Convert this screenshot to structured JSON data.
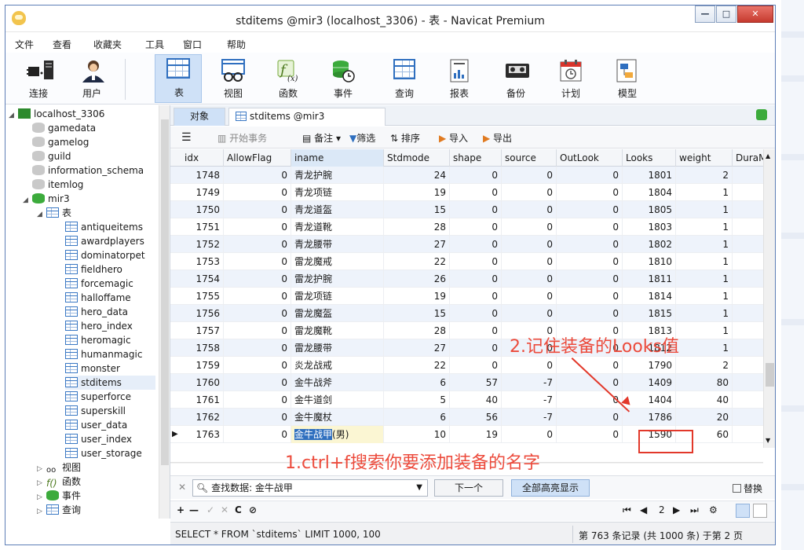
{
  "window": {
    "title": "stditems @mir3 (localhost_3306) - 表 - Navicat Premium"
  },
  "menu": [
    "文件",
    "查看",
    "收藏夹",
    "工具",
    "窗口",
    "帮助"
  ],
  "toolbar": [
    {
      "label": "连接",
      "icon": "plug-icon"
    },
    {
      "label": "用户",
      "icon": "user-icon"
    },
    {
      "label": "表",
      "icon": "table-icon",
      "active": true
    },
    {
      "label": "视图",
      "icon": "view-icon"
    },
    {
      "label": "函数",
      "icon": "function-icon"
    },
    {
      "label": "事件",
      "icon": "event-icon"
    },
    {
      "label": "查询",
      "icon": "query-icon"
    },
    {
      "label": "报表",
      "icon": "report-icon"
    },
    {
      "label": "备份",
      "icon": "backup-icon"
    },
    {
      "label": "计划",
      "icon": "schedule-icon"
    },
    {
      "label": "模型",
      "icon": "model-icon"
    }
  ],
  "tree": {
    "connection": "localhost_3306",
    "databases": [
      "gamedata",
      "gamelog",
      "guild",
      "information_schema",
      "itemlog"
    ],
    "current_db": "mir3",
    "tables_label": "表",
    "tables": [
      "antiqueitems",
      "awardplayers",
      "dominatorpet",
      "fieldhero",
      "forcemagic",
      "halloffame",
      "hero_data",
      "hero_index",
      "heromagic",
      "humanmagic",
      "monster",
      "stditems",
      "superforce",
      "superskill",
      "user_data",
      "user_index",
      "user_storage"
    ],
    "selected_table": "stditems",
    "other_nodes": [
      "视图",
      "函数",
      "事件",
      "查询"
    ]
  },
  "tabs": {
    "objects": "对象",
    "doc": "stditems @mir3 (localhost_3..."
  },
  "subtoolbar": {
    "begin_tx": "开始事务",
    "memo": "备注",
    "filter": "筛选",
    "sort": "排序",
    "import": "导入",
    "export": "导出"
  },
  "grid": {
    "columns": [
      "idx",
      "AllowFlag",
      "iname",
      "Stdmode",
      "shape",
      "source",
      "OutLook",
      "Looks",
      "weight",
      "DuraM"
    ],
    "sorted_column": "iname",
    "rows": [
      [
        "1748",
        "0",
        "青龙护腕",
        "24",
        "0",
        "0",
        "0",
        "1801",
        "2"
      ],
      [
        "1749",
        "0",
        "青龙项链",
        "19",
        "0",
        "0",
        "0",
        "1804",
        "1"
      ],
      [
        "1750",
        "0",
        "青龙道盔",
        "15",
        "0",
        "0",
        "0",
        "1805",
        "1"
      ],
      [
        "1751",
        "0",
        "青龙道靴",
        "28",
        "0",
        "0",
        "0",
        "1803",
        "1"
      ],
      [
        "1752",
        "0",
        "青龙腰带",
        "27",
        "0",
        "0",
        "0",
        "1802",
        "1"
      ],
      [
        "1753",
        "0",
        "雷龙魔戒",
        "22",
        "0",
        "0",
        "0",
        "1810",
        "1"
      ],
      [
        "1754",
        "0",
        "雷龙护腕",
        "26",
        "0",
        "0",
        "0",
        "1811",
        "1"
      ],
      [
        "1755",
        "0",
        "雷龙项链",
        "19",
        "0",
        "0",
        "0",
        "1814",
        "1"
      ],
      [
        "1756",
        "0",
        "雷龙魔盔",
        "15",
        "0",
        "0",
        "0",
        "1815",
        "1"
      ],
      [
        "1757",
        "0",
        "雷龙魔靴",
        "28",
        "0",
        "0",
        "0",
        "1813",
        "1"
      ],
      [
        "1758",
        "0",
        "雷龙腰带",
        "27",
        "0",
        "0",
        "0",
        "1812",
        "1"
      ],
      [
        "1759",
        "0",
        "炎龙战戒",
        "22",
        "0",
        "0",
        "0",
        "1790",
        "2"
      ],
      [
        "1760",
        "0",
        "金牛战斧",
        "6",
        "57",
        "-7",
        "0",
        "1409",
        "80"
      ],
      [
        "1761",
        "0",
        "金牛道剑",
        "5",
        "40",
        "-7",
        "0",
        "1404",
        "40"
      ],
      [
        "1762",
        "0",
        "金牛魔杖",
        "6",
        "56",
        "-7",
        "0",
        "1786",
        "20"
      ],
      [
        "1763",
        "0",
        "金牛战甲(男)",
        "10",
        "19",
        "0",
        "0",
        "1590",
        "60"
      ]
    ],
    "selected_row": 15,
    "highlight_match": "金牛战甲"
  },
  "find": {
    "value": "查找数据: 金牛战甲",
    "next_label": "下一个",
    "all_label": "全部高亮显示",
    "replace_label": "替换"
  },
  "nav": {
    "page": "2"
  },
  "status": {
    "sql": "SELECT * FROM `stditems` LIMIT 1000, 100",
    "record": "第 763 条记录 (共 1000 条) 于第 2 页"
  },
  "annotations": {
    "step1": "1.ctrl+f搜索你要添加装备的名字",
    "step2": "2.记住装备的Looks值"
  },
  "colors": {
    "accent": "#2f6fbf",
    "annotation": "#ec4b3c",
    "selection": "#cfe1f7"
  }
}
